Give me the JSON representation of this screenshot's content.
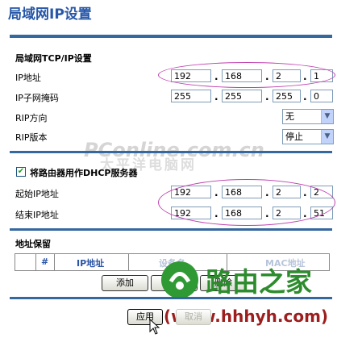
{
  "page_title": "局域网IP设置",
  "tcpip": {
    "section_title": "局域网TCP/IP设置",
    "ip_label": "IP地址",
    "ip": [
      "192",
      "168",
      "2",
      "1"
    ],
    "mask_label": "IP子网掩码",
    "mask": [
      "255",
      "255",
      "255",
      "0"
    ],
    "rip_dir_label": "RIP方向",
    "rip_dir_value": "无",
    "rip_ver_label": "RIP版本",
    "rip_ver_value": "停止"
  },
  "dhcp": {
    "checkbox_label": "将路由器用作DHCP服务器",
    "checked": true,
    "start_label": "起始IP地址",
    "start_ip": [
      "192",
      "168",
      "2",
      "2"
    ],
    "end_label": "结束IP地址",
    "end_ip": [
      "192",
      "168",
      "2",
      "51"
    ]
  },
  "reservation": {
    "section_title": "地址保留",
    "headers": [
      "#",
      "IP地址",
      "设备名",
      "MAC地址"
    ],
    "add_button": "添加",
    "edit_button": "编辑",
    "delete_button": "删除"
  },
  "footer": {
    "apply_button": "应用",
    "cancel_button": "取消"
  },
  "watermarks": {
    "pconline": "PConline.com.cn",
    "pconline_cn": "太平洋电脑网",
    "brand": "路由之家",
    "brand_url": "(www.hhhyh.com)"
  },
  "colors": {
    "title": "#2757a8",
    "rule": "#35689f",
    "highlight": "#c040b0"
  }
}
